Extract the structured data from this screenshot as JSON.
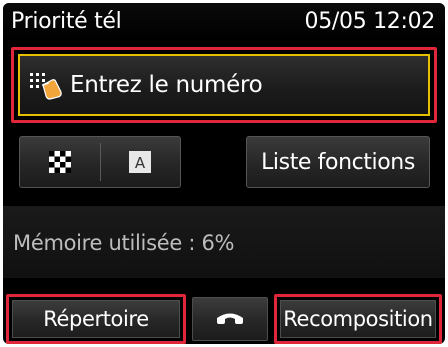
{
  "status_bar": {
    "mode_title": "Priorité tél",
    "datetime": "05/05 12:02"
  },
  "entry": {
    "label": "Entrez le numéro",
    "icon": "keypad-tap-icon"
  },
  "toolbar": {
    "mode_buttons": [
      {
        "icon": "checkered-pattern-icon"
      },
      {
        "icon": "letter-a-icon",
        "glyph": "A"
      }
    ],
    "function_list_label": "Liste fonctions"
  },
  "memory": {
    "text": "Mémoire utilisée : 6%"
  },
  "bottom": {
    "directory_label": "Répertoire",
    "hook_icon": "on-hook-phone-icon",
    "redial_label": "Recomposition"
  },
  "colors": {
    "highlight_frame": "#e0273a",
    "focus_frame": "#e6c000",
    "background": "#000000"
  }
}
